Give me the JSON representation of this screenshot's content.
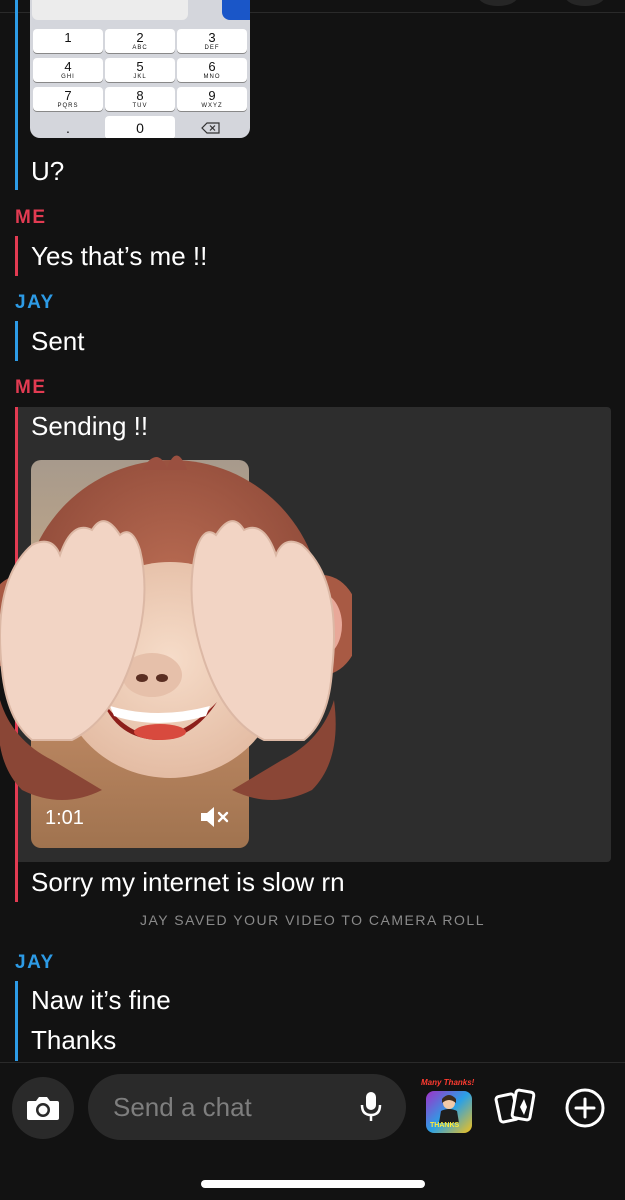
{
  "keypad": {
    "keys": [
      {
        "num": "1",
        "letters": ""
      },
      {
        "num": "2",
        "letters": "ABC"
      },
      {
        "num": "3",
        "letters": "DEF"
      },
      {
        "num": "4",
        "letters": "GHI"
      },
      {
        "num": "5",
        "letters": "JKL"
      },
      {
        "num": "6",
        "letters": "MNO"
      },
      {
        "num": "7",
        "letters": "PQRS"
      },
      {
        "num": "8",
        "letters": "TUV"
      },
      {
        "num": "9",
        "letters": "WXYZ"
      }
    ],
    "dot_key": ".",
    "zero_key": "0",
    "delete_icon": "backspace-icon"
  },
  "messages": [
    {
      "text": "U?"
    },
    {
      "sender": "ME",
      "text": "Yes that’s me !!"
    },
    {
      "sender": "JAY",
      "text": "Sent"
    },
    {
      "sender": "ME",
      "text": "Sending !!"
    },
    {
      "text": "Sorry my internet is slow rn"
    },
    {
      "sender": "JAY",
      "text": "Naw it’s fine"
    },
    {
      "text": "Thanks"
    }
  ],
  "video": {
    "duration": "1:01",
    "mute_icon": "speaker-muted-icon",
    "sticker": "see-no-evil-monkey-sticker"
  },
  "system_note": "JAY SAVED YOUR VIDEO TO CAMERA ROLL",
  "composer": {
    "placeholder": "Send a chat",
    "camera_icon": "camera-icon",
    "mic_icon": "microphone-icon",
    "bitmoji_caption": "Many Thanks!",
    "bitmoji_badge": "THANKS",
    "cards_icon": "cards-icon",
    "plus_icon": "plus-icon"
  },
  "colors": {
    "background": "#121212",
    "me_accent": "#e23b52",
    "jay_accent": "#2d9be6",
    "panel": "#2d2d2d"
  }
}
